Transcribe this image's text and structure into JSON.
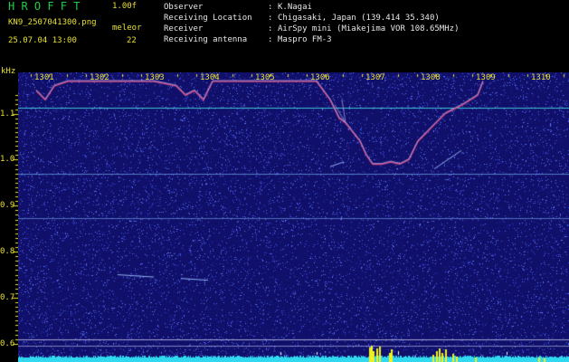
{
  "header": {
    "app_title": "H R O F F T",
    "version": "1.00f",
    "filename": "KN9_2507041300.png",
    "algorithm": "meleor",
    "timestamp": "25.07.04 13:00",
    "count": "22"
  },
  "meta": [
    {
      "label": "Observer",
      "sep": ":",
      "value": "K.Nagai"
    },
    {
      "label": "Receiving Location",
      "sep": ":",
      "value": "Chigasaki, Japan (139.414 35.340)"
    },
    {
      "label": "Receiver",
      "sep": ":",
      "value": "AirSpy mini (Miakejima VOR 108.65MHz)"
    },
    {
      "label": "Receiving antenna",
      "sep": ":",
      "value": "Maspro FM-3"
    }
  ],
  "chart_data": {
    "type": "heatmap",
    "ylabel": "kHz",
    "y_ticks": [
      "1.1",
      "1.0",
      "0.9",
      "0.8",
      "0.7",
      "0.6"
    ],
    "y_tick_values": [
      1.1,
      1.0,
      0.9,
      0.8,
      0.7,
      0.6
    ],
    "x_ticks": [
      "1301",
      "1302",
      "1303",
      "1304",
      "1305",
      "1306",
      "1307",
      "1308",
      "1309",
      "1310"
    ],
    "ylim": [
      0.58,
      1.17
    ],
    "colors": {
      "background": "#10106a",
      "noise": "#3a4ad8",
      "line": "#40d0d8",
      "trace": "#d84880",
      "bottom": "#30d8f0",
      "spikes": "#f0f020"
    }
  }
}
